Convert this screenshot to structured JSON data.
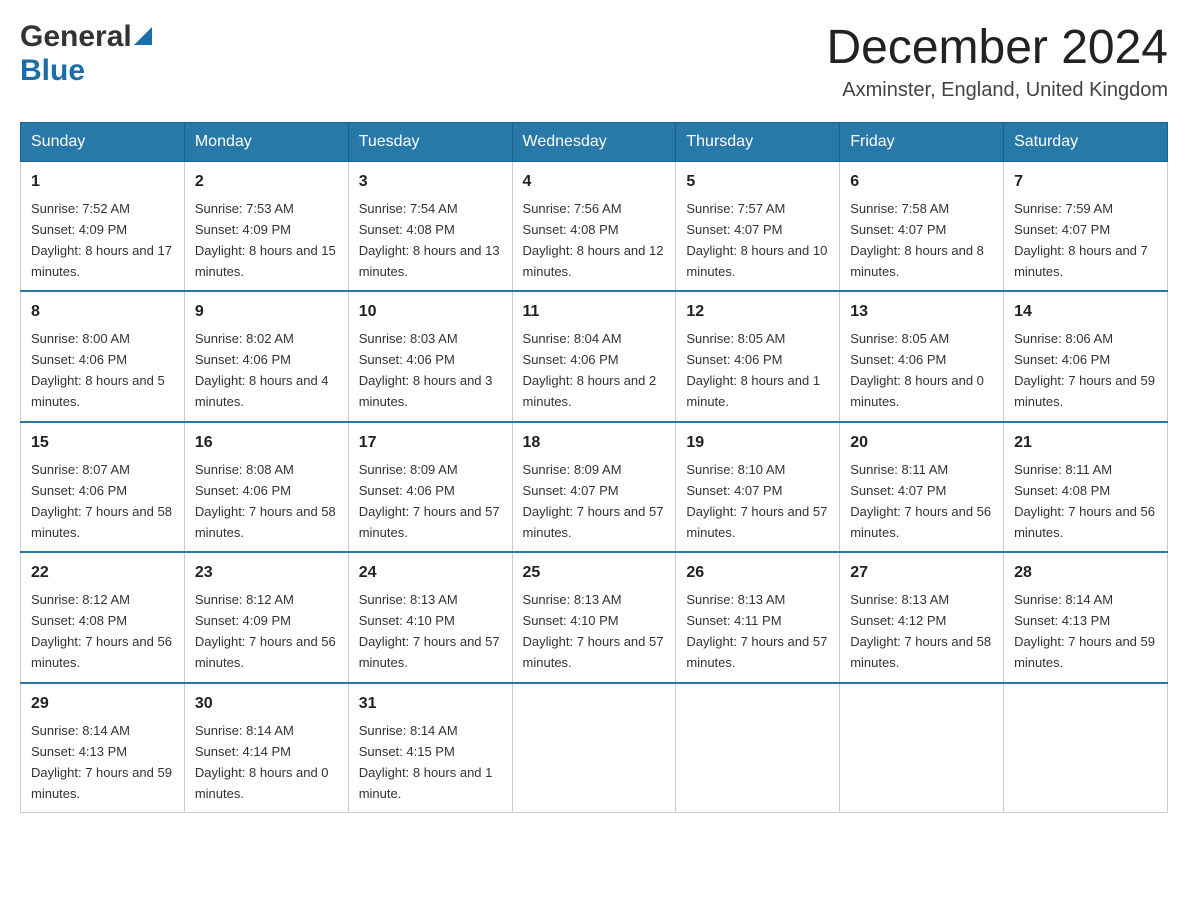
{
  "logo": {
    "general": "General",
    "blue": "Blue"
  },
  "header": {
    "month_year": "December 2024",
    "location": "Axminster, England, United Kingdom"
  },
  "columns": [
    "Sunday",
    "Monday",
    "Tuesday",
    "Wednesday",
    "Thursday",
    "Friday",
    "Saturday"
  ],
  "weeks": [
    [
      {
        "day": "1",
        "sunrise": "7:52 AM",
        "sunset": "4:09 PM",
        "daylight": "8 hours and 17 minutes."
      },
      {
        "day": "2",
        "sunrise": "7:53 AM",
        "sunset": "4:09 PM",
        "daylight": "8 hours and 15 minutes."
      },
      {
        "day": "3",
        "sunrise": "7:54 AM",
        "sunset": "4:08 PM",
        "daylight": "8 hours and 13 minutes."
      },
      {
        "day": "4",
        "sunrise": "7:56 AM",
        "sunset": "4:08 PM",
        "daylight": "8 hours and 12 minutes."
      },
      {
        "day": "5",
        "sunrise": "7:57 AM",
        "sunset": "4:07 PM",
        "daylight": "8 hours and 10 minutes."
      },
      {
        "day": "6",
        "sunrise": "7:58 AM",
        "sunset": "4:07 PM",
        "daylight": "8 hours and 8 minutes."
      },
      {
        "day": "7",
        "sunrise": "7:59 AM",
        "sunset": "4:07 PM",
        "daylight": "8 hours and 7 minutes."
      }
    ],
    [
      {
        "day": "8",
        "sunrise": "8:00 AM",
        "sunset": "4:06 PM",
        "daylight": "8 hours and 5 minutes."
      },
      {
        "day": "9",
        "sunrise": "8:02 AM",
        "sunset": "4:06 PM",
        "daylight": "8 hours and 4 minutes."
      },
      {
        "day": "10",
        "sunrise": "8:03 AM",
        "sunset": "4:06 PM",
        "daylight": "8 hours and 3 minutes."
      },
      {
        "day": "11",
        "sunrise": "8:04 AM",
        "sunset": "4:06 PM",
        "daylight": "8 hours and 2 minutes."
      },
      {
        "day": "12",
        "sunrise": "8:05 AM",
        "sunset": "4:06 PM",
        "daylight": "8 hours and 1 minute."
      },
      {
        "day": "13",
        "sunrise": "8:05 AM",
        "sunset": "4:06 PM",
        "daylight": "8 hours and 0 minutes."
      },
      {
        "day": "14",
        "sunrise": "8:06 AM",
        "sunset": "4:06 PM",
        "daylight": "7 hours and 59 minutes."
      }
    ],
    [
      {
        "day": "15",
        "sunrise": "8:07 AM",
        "sunset": "4:06 PM",
        "daylight": "7 hours and 58 minutes."
      },
      {
        "day": "16",
        "sunrise": "8:08 AM",
        "sunset": "4:06 PM",
        "daylight": "7 hours and 58 minutes."
      },
      {
        "day": "17",
        "sunrise": "8:09 AM",
        "sunset": "4:06 PM",
        "daylight": "7 hours and 57 minutes."
      },
      {
        "day": "18",
        "sunrise": "8:09 AM",
        "sunset": "4:07 PM",
        "daylight": "7 hours and 57 minutes."
      },
      {
        "day": "19",
        "sunrise": "8:10 AM",
        "sunset": "4:07 PM",
        "daylight": "7 hours and 57 minutes."
      },
      {
        "day": "20",
        "sunrise": "8:11 AM",
        "sunset": "4:07 PM",
        "daylight": "7 hours and 56 minutes."
      },
      {
        "day": "21",
        "sunrise": "8:11 AM",
        "sunset": "4:08 PM",
        "daylight": "7 hours and 56 minutes."
      }
    ],
    [
      {
        "day": "22",
        "sunrise": "8:12 AM",
        "sunset": "4:08 PM",
        "daylight": "7 hours and 56 minutes."
      },
      {
        "day": "23",
        "sunrise": "8:12 AM",
        "sunset": "4:09 PM",
        "daylight": "7 hours and 56 minutes."
      },
      {
        "day": "24",
        "sunrise": "8:13 AM",
        "sunset": "4:10 PM",
        "daylight": "7 hours and 57 minutes."
      },
      {
        "day": "25",
        "sunrise": "8:13 AM",
        "sunset": "4:10 PM",
        "daylight": "7 hours and 57 minutes."
      },
      {
        "day": "26",
        "sunrise": "8:13 AM",
        "sunset": "4:11 PM",
        "daylight": "7 hours and 57 minutes."
      },
      {
        "day": "27",
        "sunrise": "8:13 AM",
        "sunset": "4:12 PM",
        "daylight": "7 hours and 58 minutes."
      },
      {
        "day": "28",
        "sunrise": "8:14 AM",
        "sunset": "4:13 PM",
        "daylight": "7 hours and 59 minutes."
      }
    ],
    [
      {
        "day": "29",
        "sunrise": "8:14 AM",
        "sunset": "4:13 PM",
        "daylight": "7 hours and 59 minutes."
      },
      {
        "day": "30",
        "sunrise": "8:14 AM",
        "sunset": "4:14 PM",
        "daylight": "8 hours and 0 minutes."
      },
      {
        "day": "31",
        "sunrise": "8:14 AM",
        "sunset": "4:15 PM",
        "daylight": "8 hours and 1 minute."
      },
      null,
      null,
      null,
      null
    ]
  ]
}
